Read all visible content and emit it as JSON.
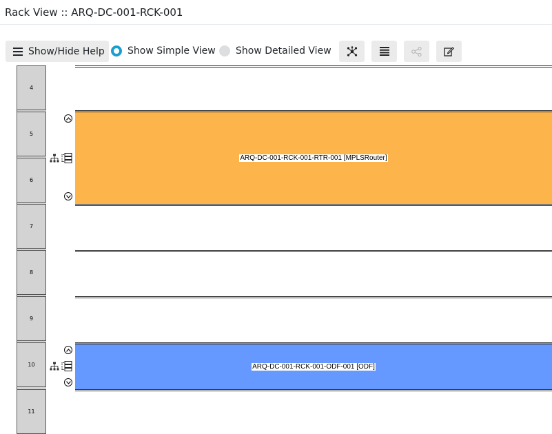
{
  "header": {
    "title": "Rack View :: ARQ-DC-001-RCK-001"
  },
  "toolbar": {
    "help_label": "Show/Hide Help",
    "simple_view_label": "Show Simple View",
    "detailed_view_label": "Show Detailed View",
    "selected_view": "Show Simple View",
    "tools": [
      {
        "icon": "topology-icon",
        "enabled": true
      },
      {
        "icon": "list-icon",
        "enabled": true
      },
      {
        "icon": "share-icon",
        "enabled": false
      },
      {
        "icon": "edit-icon",
        "enabled": true
      }
    ]
  },
  "rack": {
    "units": [
      "4",
      "5",
      "6",
      "7",
      "8",
      "9",
      "10",
      "11"
    ],
    "devices": [
      {
        "label": "ARQ-DC-001-RCK-001-RTR-001 [MPLSRouter]",
        "units": [
          "5",
          "6"
        ],
        "color": "#fdb44b"
      },
      {
        "label": "ARQ-DC-001-RCK-001-ODF-001 [ODF]",
        "units": [
          "10"
        ],
        "color": "#6699ff"
      }
    ]
  },
  "colors": {
    "accent": "#1a9fd0",
    "router": "#fdb44b",
    "odf": "#6699ff",
    "unit_bg": "#d3d3d3"
  }
}
